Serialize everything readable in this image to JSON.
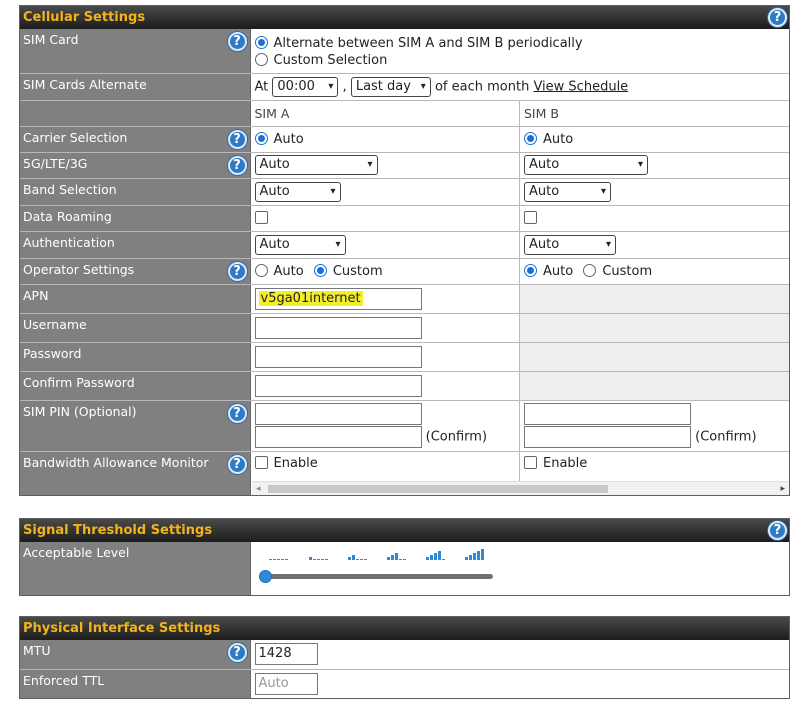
{
  "cellular": {
    "title": "Cellular Settings",
    "sim_card": {
      "label": "SIM Card",
      "opt1": "Alternate between SIM A and SIM B periodically",
      "opt2": "Custom Selection"
    },
    "sim_alt": {
      "label": "SIM Cards Alternate",
      "at": "At",
      "time": "00:00",
      "day": "Last day",
      "suffix": "of each month",
      "link": "View Schedule"
    },
    "col_a": "SIM A",
    "col_b": "SIM B",
    "carrier": {
      "label": "Carrier Selection",
      "a": "Auto",
      "b": "Auto"
    },
    "network": {
      "label": "5G/LTE/3G",
      "a": "Auto",
      "b": "Auto"
    },
    "band": {
      "label": "Band Selection",
      "a": "Auto",
      "b": "Auto"
    },
    "roaming": {
      "label": "Data Roaming"
    },
    "auth": {
      "label": "Authentication",
      "a": "Auto",
      "b": "Auto"
    },
    "operator": {
      "label": "Operator Settings",
      "auto": "Auto",
      "custom": "Custom"
    },
    "apn": {
      "label": "APN",
      "a": "v5ga01internet"
    },
    "username": {
      "label": "Username"
    },
    "password": {
      "label": "Password"
    },
    "confirm": {
      "label": "Confirm Password"
    },
    "simpin": {
      "label": "SIM PIN (Optional)",
      "confirm": "(Confirm)"
    },
    "bandwidth": {
      "label": "Bandwidth Allowance Monitor",
      "enable": "Enable"
    }
  },
  "signal": {
    "title": "Signal Threshold Settings",
    "level_label": "Acceptable Level",
    "level_value": 0
  },
  "physical": {
    "title": "Physical Interface Settings",
    "mtu_label": "MTU",
    "mtu_value": "1428",
    "ttl_label": "Enforced TTL",
    "ttl_placeholder": "Auto"
  },
  "colors": {
    "header_text": "#f3b31a",
    "label_bg": "#808080",
    "help_icon": "#2e7ac5",
    "signal_bar": "#2e8ad8"
  },
  "icons": {
    "help": "?",
    "dropdown": "▾"
  }
}
